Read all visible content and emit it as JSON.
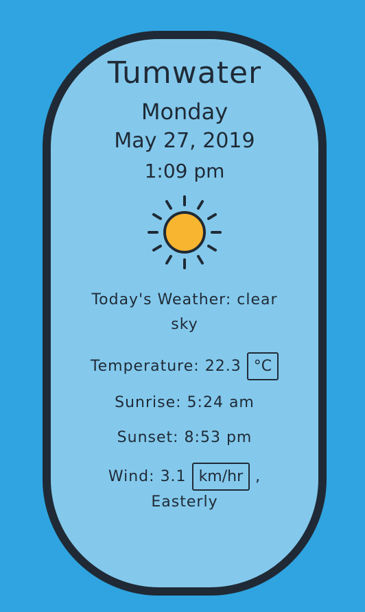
{
  "location": {
    "city": "Tumwater",
    "day": "Monday",
    "date": "May 27, 2019",
    "time": "1:09 pm"
  },
  "weather": {
    "icon": "sun-icon",
    "summary_label": "Today's Weather:",
    "summary_value": "clear sky",
    "temperature_label": "Temperature:",
    "temperature_value": "22.3",
    "temperature_unit_button": "°C",
    "sunrise_label": "Sunrise:",
    "sunrise_value": "5:24 am",
    "sunset_label": "Sunset:",
    "sunset_value": "8:53 pm",
    "wind_label": "Wind:",
    "wind_value": "3.1",
    "wind_unit_button": "km/hr",
    "wind_separator": ",",
    "wind_direction": "Easterly"
  },
  "colors": {
    "background": "#2fa4e0",
    "card_fill": "#84c9ec",
    "card_border": "#1f2a36",
    "sun_fill": "#f8b530"
  }
}
